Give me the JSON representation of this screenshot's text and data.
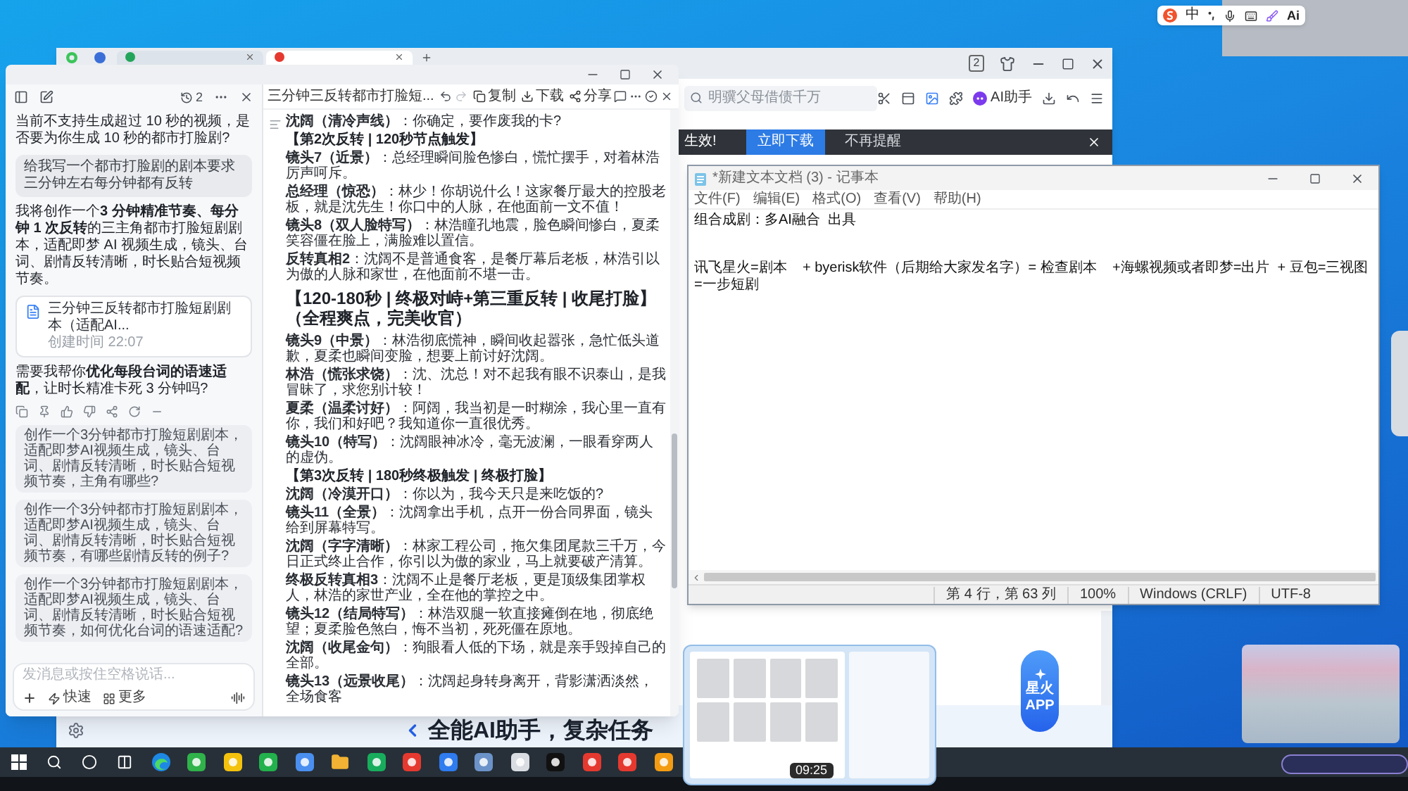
{
  "tray": {
    "ime_mode": "中",
    "ai_label": "Ai"
  },
  "browser": {
    "tabs": [
      {
        "selected": false
      },
      {
        "selected": true
      }
    ],
    "tab_count": "2",
    "search": {
      "placeholder": "明骥父母借债千万"
    },
    "ai_assistant": "AI助手",
    "notice": {
      "text": "生效!",
      "primary_button": "立即下载",
      "secondary_button": "不再提醒"
    },
    "app_badge": [
      "星火",
      "APP"
    ],
    "banner": "全能AI助手，复杂任务"
  },
  "assistant_window": {
    "chat": {
      "history_count": "2",
      "messages": [
        {
          "kind": "assistant",
          "text": "当前不支持生成超过 10 秒的视频，是否要为你生成 10 秒的都市打脸剧?"
        },
        {
          "kind": "user",
          "text": "给我写一个都市打脸剧的剧本要求三分钟左右每分钟都有反转"
        },
        {
          "kind": "assistant",
          "text": "我将创作一个**3 分钟精准节奏、每分钟 1 次反转**的三主角都市打脸短剧剧本，适配即梦 AI 视频生成，镜头、台词、剧情反转清晰，时长贴合短视频节奏。"
        },
        {
          "kind": "file",
          "title": "三分钟三反转都市打脸短剧剧本（适配AI...",
          "meta": "创建时间 22:07"
        },
        {
          "kind": "assistant",
          "text": "需要我帮你**优化每段台词的语速适配**，让时长精准卡死 3 分钟吗?"
        }
      ],
      "suggestions": [
        "创作一个3分钟都市打脸短剧剧本，适配即梦AI视频生成，镜头、台词、剧情反转清晰，时长贴合短视频节奏，主角有哪些?",
        "创作一个3分钟都市打脸短剧剧本，适配即梦AI视频生成，镜头、台词、剧情反转清晰，时长贴合短视频节奏，有哪些剧情反转的例子?",
        "创作一个3分钟都市打脸短剧剧本，适配即梦AI视频生成，镜头、台词、剧情反转清晰，时长贴合短视频节奏，如何优化台词的语速适配?"
      ],
      "input": {
        "placeholder": "发消息或按住空格说话...",
        "tools": [
          {
            "kind": "quick",
            "label": "快速"
          },
          {
            "kind": "more",
            "label": "更多"
          }
        ]
      }
    },
    "document": {
      "title": "三分钟三反转都市打脸短...",
      "actions": [
        {
          "kind": "copy",
          "label": "复制"
        },
        {
          "kind": "download",
          "label": "下载"
        },
        {
          "kind": "share",
          "label": "分享"
        }
      ],
      "blocks": [
        {
          "kind": "para",
          "text": "**沈阔（清冷声线）**：你确定，要作废我的卡?"
        },
        {
          "kind": "marker",
          "text": "【第2次反转 | 120秒节点触发】"
        },
        {
          "kind": "para",
          "text": "**镜头7（近景）**：总经理瞬间脸色惨白，慌忙摆手，对着林浩厉声呵斥。"
        },
        {
          "kind": "para",
          "text": "**总经理（惊恐）**：林少！你胡说什么！这家餐厅最大的控股老板，就是沈先生！你口中的人脉，在他面前一文不值！"
        },
        {
          "kind": "para",
          "text": "**镜头8（双人脸特写）**：林浩瞳孔地震，脸色瞬间惨白，夏柔笑容僵在脸上，满脸难以置信。"
        },
        {
          "kind": "para",
          "text": "**反转真相2**：沈阔不是普通食客，是餐厅幕后老板，林浩引以为傲的人脉和家世，在他面前不堪一击。"
        },
        {
          "kind": "heading",
          "text": "【120-180秒 | 终极对峙+第三重反转 | 收尾打脸】（全程爽点，完美收官）"
        },
        {
          "kind": "para",
          "text": "**镜头9（中景）**：林浩彻底慌神，瞬间收起嚣张，急忙低头道歉，夏柔也瞬间变脸，想要上前讨好沈阔。"
        },
        {
          "kind": "para",
          "text": "**林浩（慌张求饶）**：沈、沈总！对不起我有眼不识泰山，是我冒昧了，求您别计较！"
        },
        {
          "kind": "para",
          "text": "**夏柔（温柔讨好）**：阿阔，我当初是一时糊涂，我心里一直有你，我们和好吧？我知道你一直很优秀。"
        },
        {
          "kind": "para",
          "text": "**镜头10（特写）**：沈阔眼神冰冷，毫无波澜，一眼看穿两人的虚伪。"
        },
        {
          "kind": "marker",
          "text": "【第3次反转 | 180秒终极触发 | 终极打脸】"
        },
        {
          "kind": "para",
          "text": "**沈阔（冷漠开口）**：你以为，我今天只是来吃饭的?"
        },
        {
          "kind": "para",
          "text": "**镜头11（全景）**：沈阔拿出手机，点开一份合同界面，镜头给到屏幕特写。"
        },
        {
          "kind": "para",
          "text": "**沈阔（字字清晰）**：林家工程公司，拖欠集团尾款三千万，今日正式终止合作，你引以为傲的家业，马上就要破产清算。"
        },
        {
          "kind": "para",
          "text": "**终极反转真相3**：沈阔不止是餐厅老板，更是顶级集团掌权人，林浩的家世产业，全在他的掌控之中。"
        },
        {
          "kind": "para",
          "text": "**镜头12（结局特写）**：林浩双腿一软直接瘫倒在地，彻底绝望；夏柔脸色煞白，悔不当初，死死僵在原地。"
        },
        {
          "kind": "para",
          "text": "**沈阔（收尾金句）**：狗眼看人低的下场，就是亲手毁掉自己的全部。"
        },
        {
          "kind": "para",
          "text": "**镜头13（远景收尾）**：沈阔起身转身离开，背影潇洒淡然，全场食客"
        }
      ]
    }
  },
  "notepad": {
    "title": "*新建文本文档 (3) - 记事本",
    "menu": [
      "文件(F)",
      "编辑(E)",
      "格式(O)",
      "查看(V)",
      "帮助(H)"
    ],
    "lines": [
      "组合成剧：多AI融合  出具",
      "讯飞星火=剧本    + byerisk软件（后期给大家发名字）= 检查剧本    +海螺视频或者即梦=出片  + 豆包=三视图 =一步短剧"
    ],
    "status": [
      "第 4 行，第 63 列",
      "100%",
      "Windows (CRLF)",
      "UTF-8"
    ]
  },
  "taskbar": {
    "preview_time": "09:25"
  }
}
